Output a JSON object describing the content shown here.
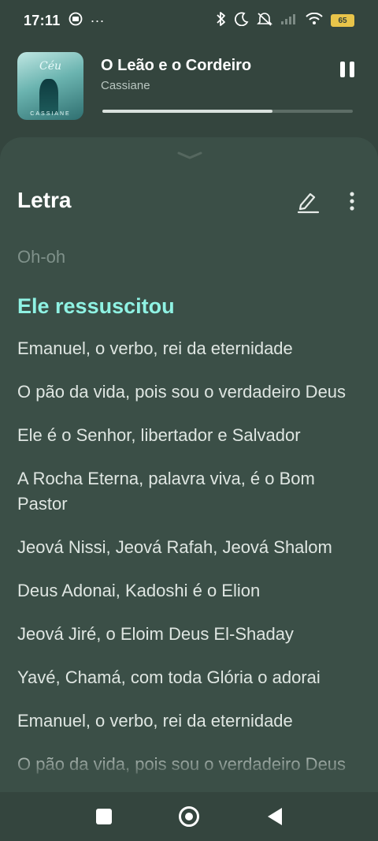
{
  "status_bar": {
    "time": "17:11",
    "more_indicator": "···",
    "battery_level": "65",
    "icons": [
      "media-icon",
      "bluetooth-icon",
      "moon-icon",
      "mute-icon",
      "signal-icon",
      "wifi-icon",
      "battery-icon"
    ]
  },
  "now_playing": {
    "title": "O Leão e o Cordeiro",
    "artist": "Cassiane",
    "album_art_title": "Céu",
    "album_art_artist": "CASSIANE",
    "progress_fraction": 0.68
  },
  "lyrics": {
    "header": "Letra",
    "lines": [
      {
        "text": "Oh-oh",
        "state": "past"
      },
      {
        "text": "Ele ressuscitou",
        "state": "current"
      },
      {
        "text": "Emanuel, o verbo, rei da eternidade",
        "state": "upcoming"
      },
      {
        "text": "O pão da vida, pois sou o verdadeiro Deus",
        "state": "upcoming"
      },
      {
        "text": "Ele é o Senhor, libertador e Salvador",
        "state": "upcoming"
      },
      {
        "text": "A Rocha Eterna, palavra viva, é o Bom Pastor",
        "state": "upcoming"
      },
      {
        "text": "Jeová Nissi, Jeová Rafah, Jeová Shalom",
        "state": "upcoming"
      },
      {
        "text": "Deus Adonai, Kadoshi é o Elion",
        "state": "upcoming"
      },
      {
        "text": "Jeová Jiré, o Eloim Deus El-Shaday",
        "state": "upcoming"
      },
      {
        "text": "Yavé, Chamá, com toda Glória o adorai",
        "state": "upcoming"
      },
      {
        "text": "Emanuel, o verbo, rei da eternidade",
        "state": "upcoming"
      },
      {
        "text": "O pão da vida, pois sou o verdadeiro Deus",
        "state": "upcoming"
      }
    ]
  },
  "colors": {
    "background": "#34453e",
    "panel": "#3b4f47",
    "current_line": "#8ff2e3",
    "past_line": "#7f918a"
  }
}
